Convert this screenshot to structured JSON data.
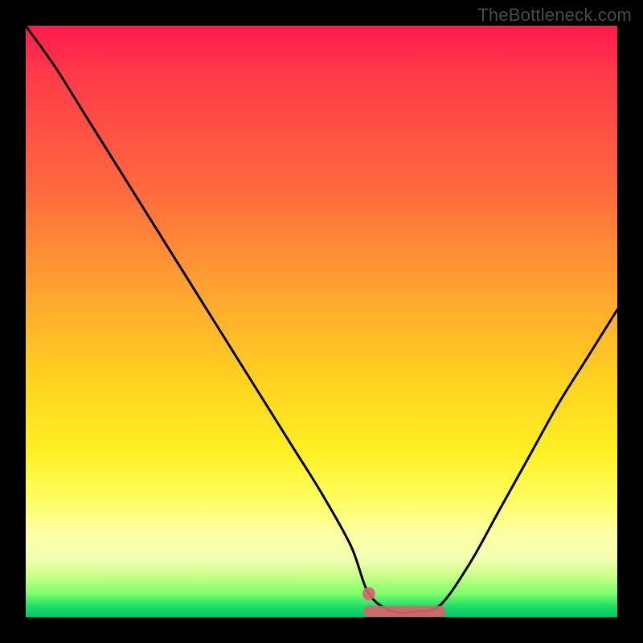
{
  "watermark": {
    "text": "TheBottleneck.com"
  },
  "chart_data": {
    "type": "line",
    "title": "",
    "xlabel": "",
    "ylabel": "",
    "xlim": [
      0,
      100
    ],
    "ylim": [
      0,
      100
    ],
    "grid": false,
    "legend": false,
    "series": [
      {
        "name": "bottleneck-curve",
        "x": [
          0,
          5,
          10,
          15,
          20,
          25,
          30,
          35,
          40,
          45,
          50,
          55,
          58,
          62,
          66,
          70,
          75,
          80,
          85,
          90,
          95,
          100
        ],
        "y": [
          100,
          93,
          85,
          77,
          69,
          61,
          53,
          45,
          37,
          29,
          21,
          12,
          4,
          1,
          1,
          2,
          9,
          18,
          27,
          36,
          44,
          52
        ]
      }
    ],
    "markers": [
      {
        "name": "flat-bottom-band",
        "x0": 58,
        "x1": 70,
        "y": 1
      },
      {
        "name": "min-start-dot",
        "x": 58,
        "y": 4
      }
    ],
    "colors": {
      "curve": "#000000",
      "marker": "#d9636a",
      "gradient_top": "#ff1a4d",
      "gradient_mid": "#ffd21f",
      "gradient_bottom": "#00c46a"
    },
    "notes": "V-shaped bottleneck curve over a vertical heat gradient; minimum (optimal) around x≈62–66 where y≈1. Values estimated from pixel positions; no axis ticks or numeric labels are rendered."
  }
}
